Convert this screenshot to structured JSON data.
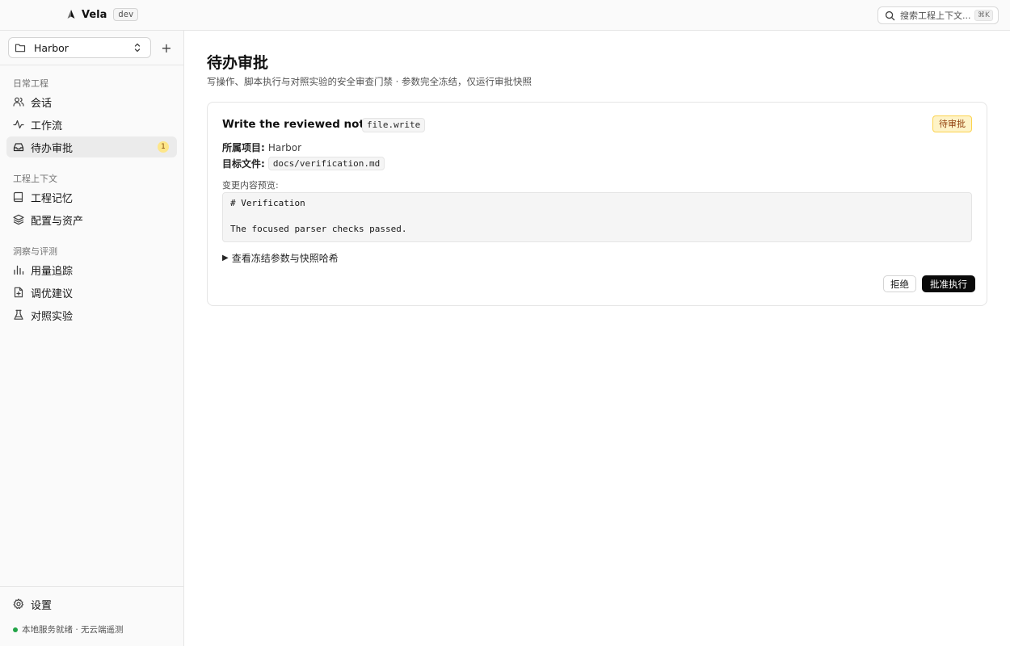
{
  "app": {
    "name": "Vela",
    "env": "dev"
  },
  "search": {
    "placeholder": "搜索工程上下文...",
    "shortcut": "⌘K"
  },
  "sidebar": {
    "project": {
      "name": "Harbor",
      "add_label": "+"
    },
    "groups": [
      {
        "label": "日常工程",
        "items": [
          {
            "label": "会话",
            "icon": "users-icon"
          },
          {
            "label": "工作流",
            "icon": "activity-icon"
          },
          {
            "label": "待办审批",
            "icon": "inbox-icon",
            "active": true,
            "count": "1"
          }
        ]
      },
      {
        "label": "工程上下文",
        "items": [
          {
            "label": "工程记忆",
            "icon": "book-icon"
          },
          {
            "label": "配置与资产",
            "icon": "layers-icon"
          }
        ]
      },
      {
        "label": "洞察与评测",
        "items": [
          {
            "label": "用量追踪",
            "icon": "bar-chart-icon"
          },
          {
            "label": "调优建议",
            "icon": "file-plus-icon"
          },
          {
            "label": "对照实验",
            "icon": "flask-icon"
          }
        ]
      }
    ],
    "footer": {
      "settings_label": "设置",
      "status_text": "本地服务就绪 · 无云端遥测",
      "status_color": "#22a447"
    }
  },
  "main": {
    "title": "待办审批",
    "subtitle": "写操作、脚本执行与对照实验的安全审查门禁 · 参数完全冻结，仅运行审批快照",
    "approval": {
      "title": "Write the reviewed note",
      "tool": "file.write",
      "status": "待审批",
      "project_key": "所属项目:",
      "project_value": "Harbor",
      "file_key": "目标文件:",
      "file_value": "docs/verification.md",
      "preview_label": "变更内容预览:",
      "preview_lines": [
        "# Verification",
        "",
        "The focused parser checks passed."
      ],
      "details_toggle": "查看冻结参数与快照哈希",
      "reject_label": "拒绝",
      "approve_label": "批准执行"
    }
  },
  "colors": {
    "accent": "#0a0a0a",
    "pending_bg": "#fef3c7",
    "pending_text": "#92400e",
    "badge_bg": "#fde68a"
  }
}
